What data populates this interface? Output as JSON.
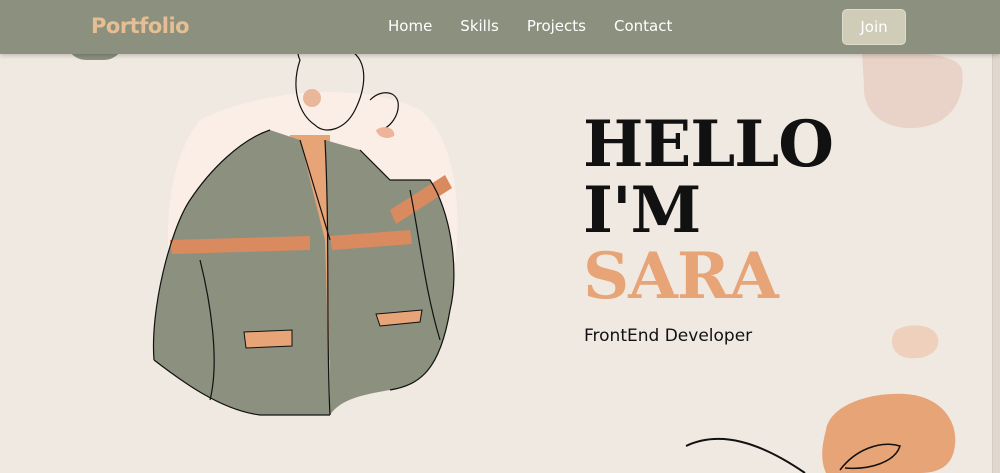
{
  "navbar": {
    "brand": "Portfolio",
    "links": [
      {
        "label": "Home"
      },
      {
        "label": "Skills"
      },
      {
        "label": "Projects"
      },
      {
        "label": "Contact"
      }
    ],
    "join_label": "Join"
  },
  "hero": {
    "line1": "HELLO",
    "line2": "I'M",
    "name": "SARA",
    "subtitle": "FrontEnd Developer"
  },
  "colors": {
    "nav_background": "#8b907f",
    "brand": "#e6be93",
    "page_background": "#f0e9e2",
    "accent_orange": "#e6a477",
    "jacket_green": "#8b907f"
  }
}
